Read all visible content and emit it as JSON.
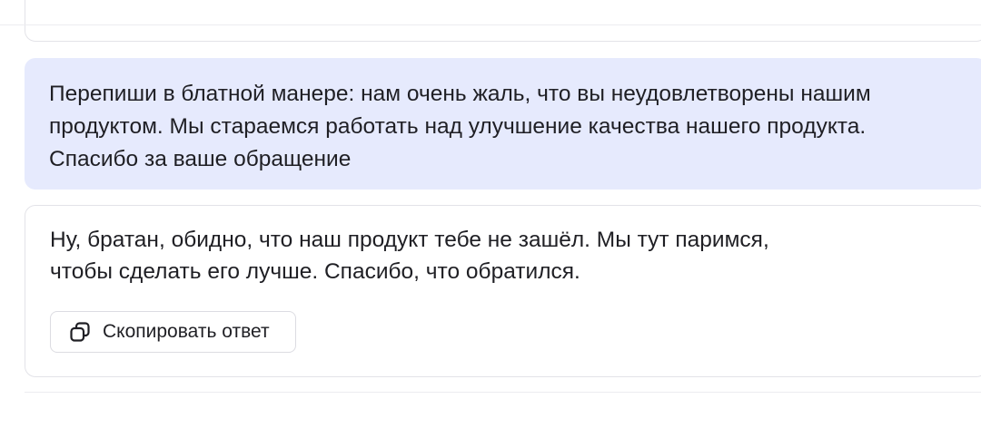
{
  "chat": {
    "user_message": "Перепиши в блатной манере: нам очень жаль, что вы неудовлетворены нашим\nпродуктом. Мы стараемся работать над улучшение качества нашего продукта.\nСпасибо за ваше обращение",
    "assistant_message": "Ну, братан, обидно, что наш продукт тебе не зашёл. Мы тут паримся,\nчтобы сделать его лучше. Спасибо, что обратился.",
    "copy_button_label": "Скопировать ответ"
  },
  "icons": {
    "copy": "copy-icon"
  },
  "colors": {
    "user_bubble_bg": "#e6eafd",
    "text": "#1f1f24",
    "card_border": "#e3e3e8"
  }
}
